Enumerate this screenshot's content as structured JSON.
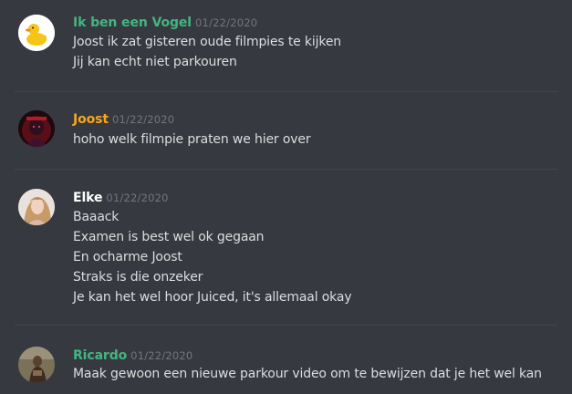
{
  "messages": [
    {
      "username": "Ik ben een Vogel",
      "username_color": "#43b581",
      "timestamp": "01/22/2020",
      "avatar_icon": "duck-avatar",
      "lines": [
        "Joost ik zat gisteren oude filmpies te kijken",
        "Jij kan echt niet parkouren"
      ]
    },
    {
      "username": "Joost",
      "username_color": "#faa61a",
      "timestamp": "01/22/2020",
      "avatar_icon": "dark-red-avatar",
      "lines": [
        "hoho welk filmpie praten we hier over"
      ]
    },
    {
      "username": "Elke",
      "username_color": "#ffffff",
      "timestamp": "01/22/2020",
      "avatar_icon": "photo-avatar",
      "lines": [
        "Baaack",
        "Examen is best wel ok gegaan",
        "En ocharme Joost",
        "Straks is die onzeker",
        "Je kan het wel hoor Juiced, it's allemaal okay"
      ]
    },
    {
      "username": "Ricardo",
      "username_color": "#43b581",
      "timestamp": "01/22/2020",
      "avatar_icon": "photo-avatar",
      "lines": [
        "Maak gewoon een nieuwe parkour video om te bewijzen dat je het wel kan"
      ]
    }
  ]
}
